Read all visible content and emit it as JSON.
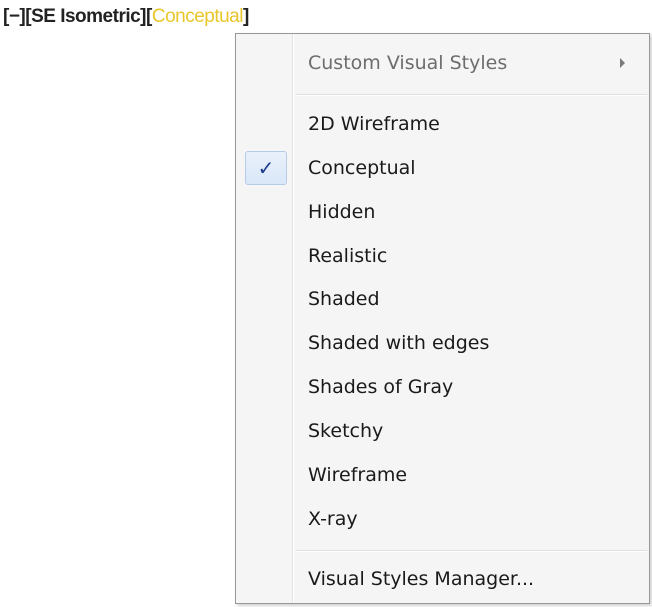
{
  "viewport": {
    "controls_label": "[−]",
    "view_label": "[SE Isometric]",
    "style_open_bracket": "[",
    "style_label": "Conceptual",
    "style_close_bracket": "]"
  },
  "menu": {
    "header_item": {
      "label": "Custom Visual Styles",
      "disabled": true,
      "has_submenu": true
    },
    "items": [
      {
        "label": "2D Wireframe",
        "checked": false
      },
      {
        "label": "Conceptual",
        "checked": true
      },
      {
        "label": "Hidden",
        "checked": false
      },
      {
        "label": "Realistic",
        "checked": false
      },
      {
        "label": "Shaded",
        "checked": false
      },
      {
        "label": "Shaded with edges",
        "checked": false
      },
      {
        "label": "Shades of Gray",
        "checked": false
      },
      {
        "label": "Sketchy",
        "checked": false
      },
      {
        "label": "Wireframe",
        "checked": false
      },
      {
        "label": "X-ray",
        "checked": false
      }
    ],
    "footer_item": {
      "label": "Visual Styles Manager..."
    },
    "check_glyph": "✓"
  },
  "colors": {
    "active_style": "#e8c62a",
    "menu_background": "#f5f5f5",
    "menu_border": "#979797",
    "check_color": "#1b3b8c"
  },
  "icons": {
    "submenu": "chevron-right-icon",
    "check": "checkmark-icon"
  }
}
